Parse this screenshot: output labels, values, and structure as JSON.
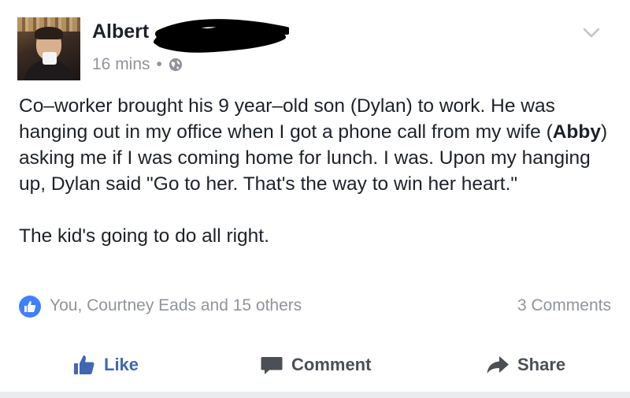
{
  "post": {
    "author": "Albert",
    "time": "16 mins",
    "separator": "•",
    "audience_icon": "globe-icon",
    "body": {
      "line1a": "Co–worker brought his 9 year–old son (Dylan) to work. He was hanging out in my office when I got a phone call from my wife (",
      "bold": "Abby",
      "line1b": ") asking me if I was coming home for lunch. I was. Upon my hanging up, Dylan said \"Go to her. That's the way to win her heart.\"",
      "paragraph2": "The kid's going to do all right."
    },
    "reactions": {
      "text": "You, Courtney Eads and 15 others",
      "comments": "3 Comments"
    }
  },
  "actions": {
    "like": "Like",
    "comment": "Comment",
    "share": "Share"
  },
  "colors": {
    "like_blue": "#4267b2",
    "reaction_blue": "#4080ff",
    "meta_gray": "#90949c"
  }
}
